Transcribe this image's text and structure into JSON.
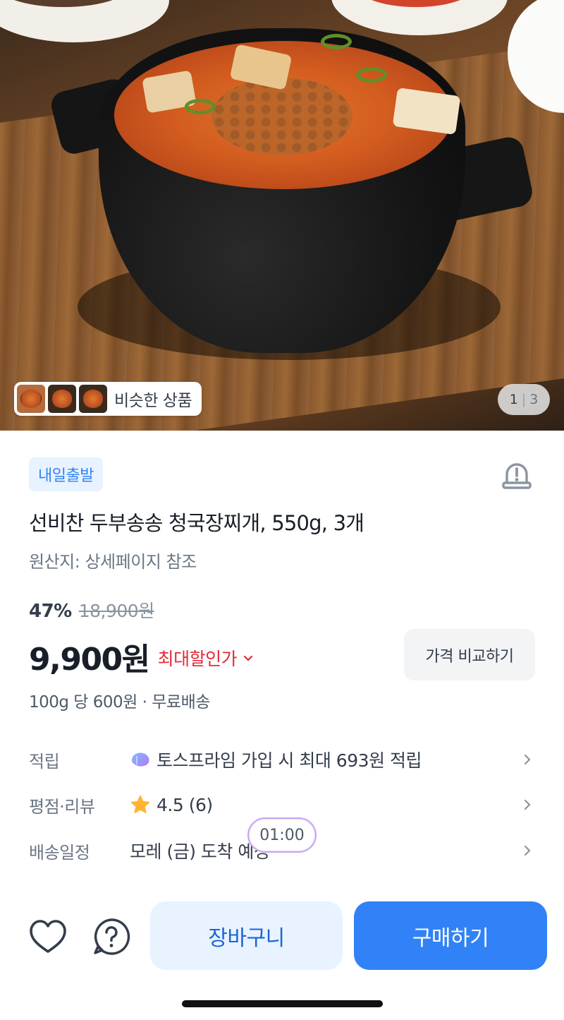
{
  "hero": {
    "similar_label": "비슷한 상품",
    "counter_current": "1",
    "counter_separator": "|",
    "counter_total": "3"
  },
  "badge": "내일출발",
  "product": {
    "title": "선비찬 두부송송 청국장찌개, 550g, 3개",
    "origin": "원산지: 상세페이지 참조",
    "discount": "47%",
    "original_price": "18,900원",
    "price": "9,900원",
    "lowest_label": "최대할인가",
    "compare_label": "가격 비교하기",
    "unit_info": "100g 당 600원 · 무료배송"
  },
  "info_rows": [
    {
      "key": "적립",
      "value": "토스프라임 가입 시 최대 693원 적립"
    },
    {
      "key": "평점·리뷰",
      "value": "4.5 (6)"
    },
    {
      "key": "배송일정",
      "value": "모레 (금) 도착 예정"
    }
  ],
  "timer": "01:00",
  "actions": {
    "cart_label": "장바구니",
    "buy_label": "구매하기"
  },
  "colors": {
    "accent": "#3182f6",
    "accent_light": "#e8f3ff",
    "discount_red": "#e42939",
    "star": "#ffb331"
  },
  "icons": [
    "alert-siren-icon",
    "chevron-down-icon",
    "prime-icon",
    "star-icon",
    "chevron-right-icon",
    "heart-icon",
    "help-icon"
  ]
}
